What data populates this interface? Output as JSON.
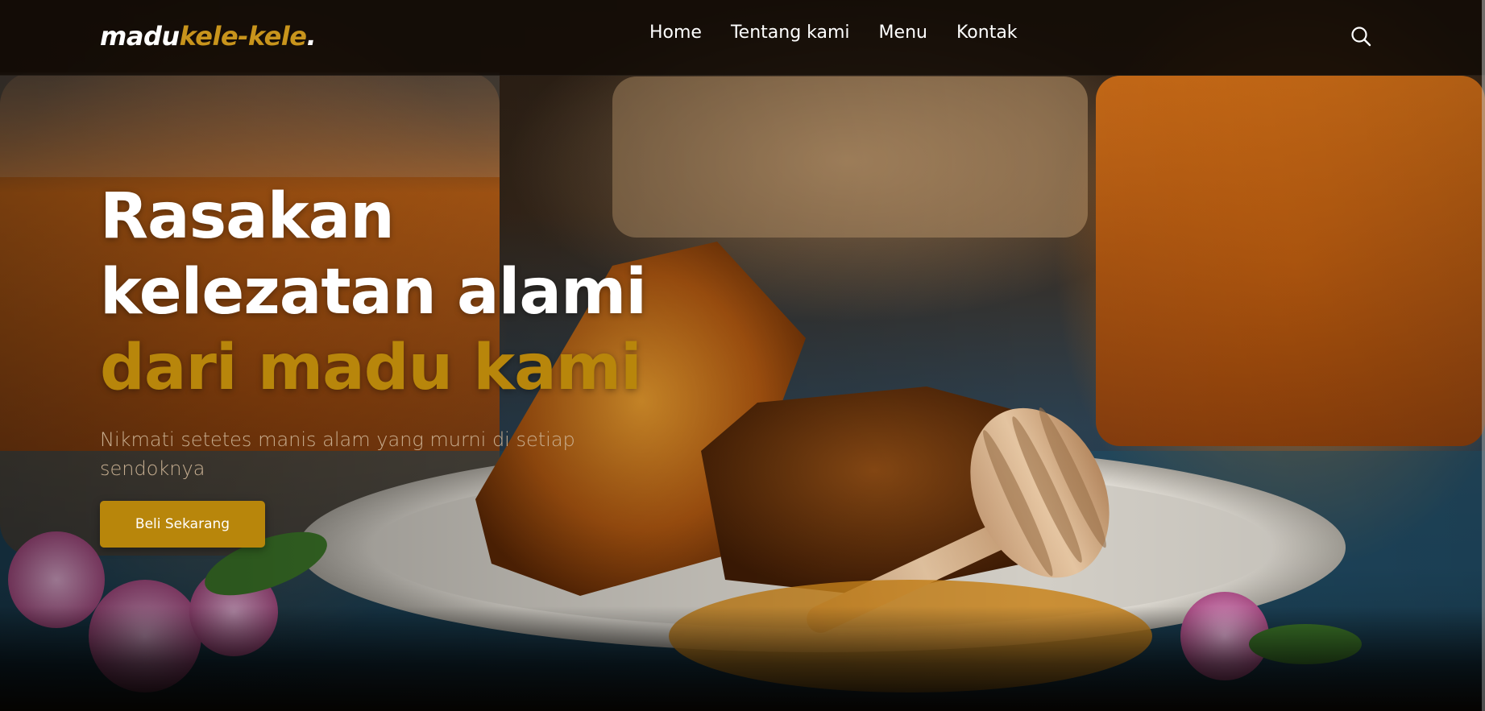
{
  "brand": {
    "logo_main": "madu",
    "logo_accent": "kele-kele",
    "logo_dot": "."
  },
  "nav": {
    "items": [
      {
        "label": "Home"
      },
      {
        "label": "Tentang kami"
      },
      {
        "label": "Menu"
      },
      {
        "label": "Kontak"
      }
    ],
    "search_icon": "search-icon"
  },
  "hero": {
    "headline_line1": "Rasakan",
    "headline_line2": "kelezatan alami",
    "headline_line3": "dari madu kami",
    "subtext": "Nikmati setetes manis alam yang murni di setiap sendoknya",
    "cta_label": "Beli Sekarang",
    "background_image": "honeycomb-and-honey-dipper-photo"
  },
  "colors": {
    "accent": "#b8860b",
    "navbar": "#120b06",
    "text": "#ffffff"
  }
}
